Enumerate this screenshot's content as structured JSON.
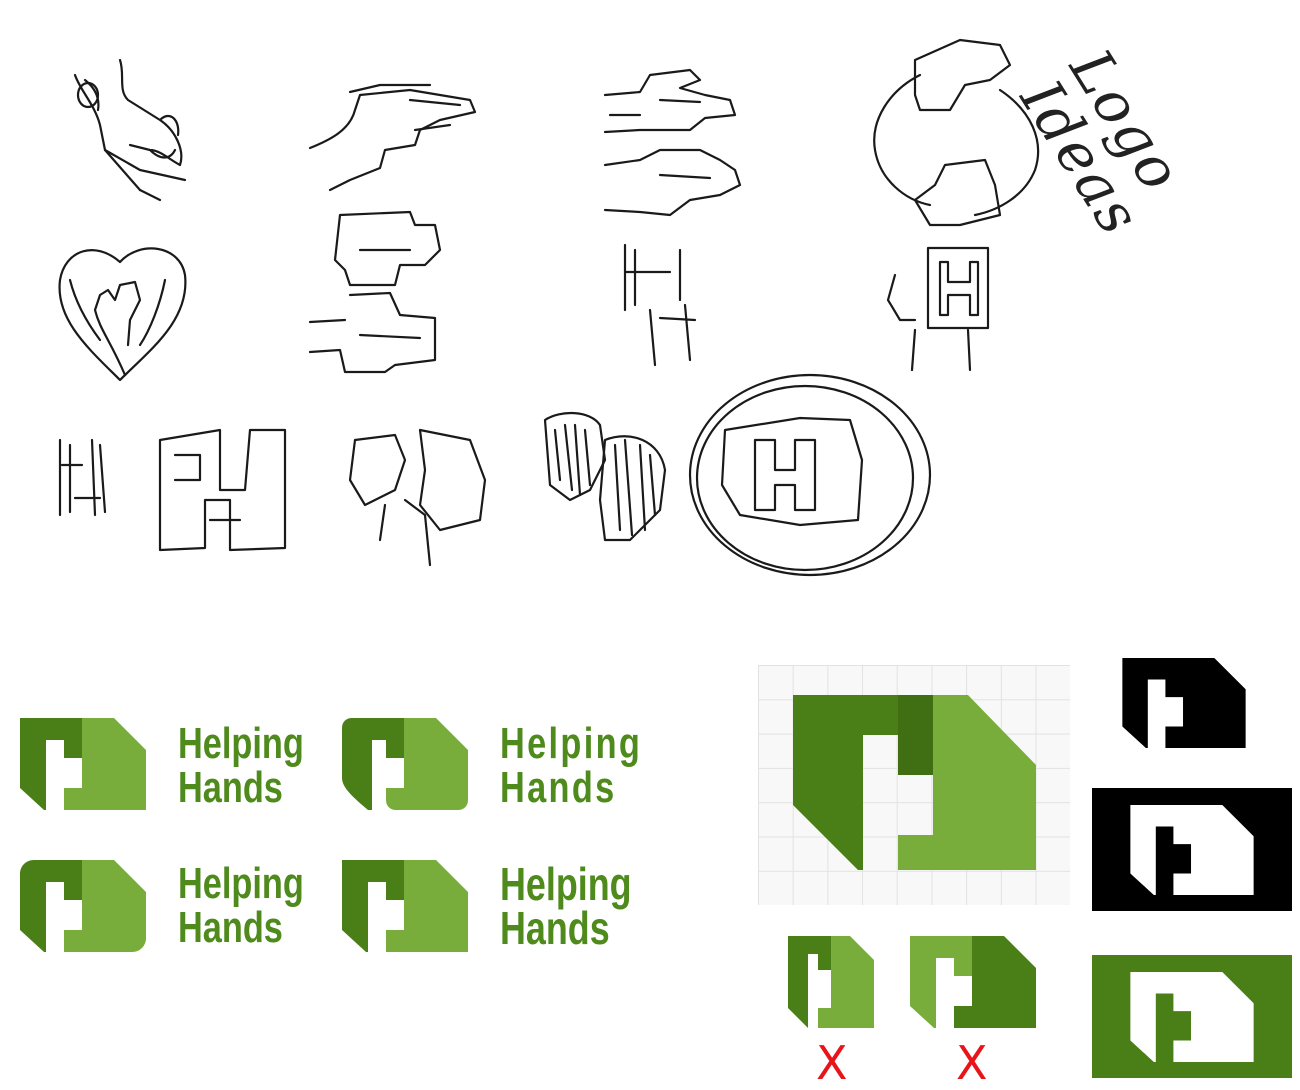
{
  "sketches": {
    "handwritten_note": "Logo Ideas"
  },
  "logo_variants": [
    {
      "line1": "Helping",
      "line2": "Hands"
    },
    {
      "line1": "Helping",
      "line2": "Hands"
    },
    {
      "line1": "Helping",
      "line2": "Hands"
    },
    {
      "line1": "Helping",
      "line2": "Hands"
    }
  ],
  "rejected_marks": [
    {
      "label": "X"
    },
    {
      "label": "X"
    }
  ],
  "colors": {
    "dark_green": "#4a7f17",
    "light_green": "#78ad3c",
    "reject_red": "#e8141a",
    "black": "#000000"
  },
  "icons": [
    "helping-hands-logo-icon"
  ]
}
